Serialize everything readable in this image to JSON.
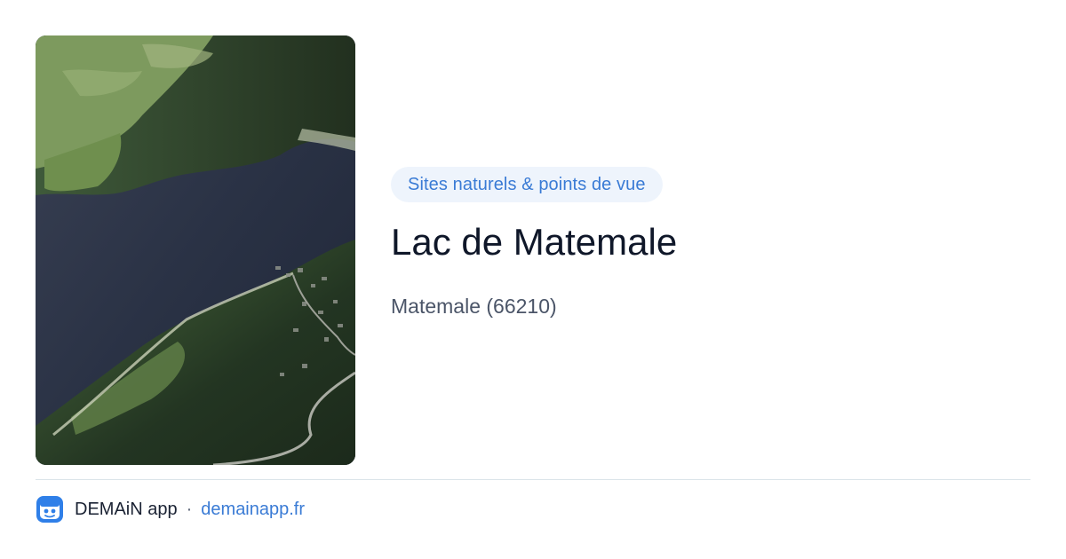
{
  "category": {
    "label": "Sites naturels & points de vue"
  },
  "place": {
    "title": "Lac de Matemale",
    "location": "Matemale (66210)"
  },
  "footer": {
    "app_name": "DEMAiN app",
    "separator": "·",
    "domain": "demainapp.fr"
  },
  "photo": {
    "icon": "aerial-lake-photo"
  },
  "colors": {
    "accent": "#3a7bd5",
    "pill_background": "#eef4fc",
    "title": "#0f1729",
    "subtitle": "#4b5568",
    "divider": "#dbe4ea"
  }
}
